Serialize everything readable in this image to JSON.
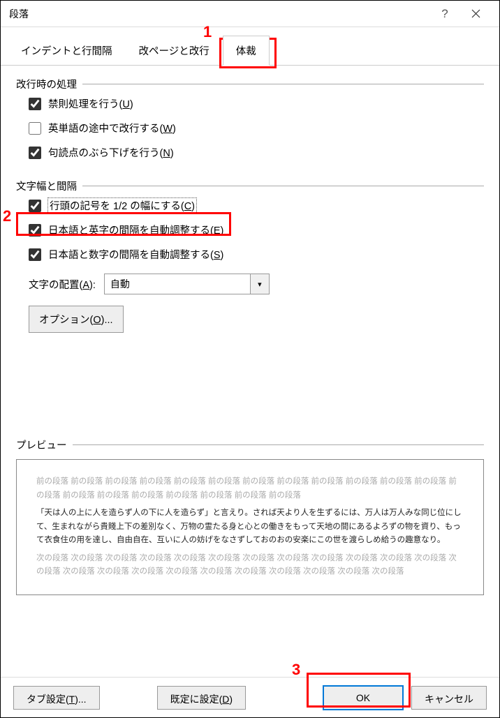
{
  "title": "段落",
  "tabs": [
    {
      "label": "インデントと行間隔",
      "active": false
    },
    {
      "label": "改ページと改行",
      "active": false
    },
    {
      "label": "体裁",
      "active": true
    }
  ],
  "groups": {
    "linebreak": {
      "legend": "改行時の処理",
      "items": [
        {
          "label": "禁則処理を行う(",
          "key": "U",
          "suffix": ")",
          "checked": true
        },
        {
          "label": "英単語の途中で改行する(",
          "key": "W",
          "suffix": ")",
          "checked": false
        },
        {
          "label": "句読点のぶら下げを行う(",
          "key": "N",
          "suffix": ")",
          "checked": true
        }
      ]
    },
    "spacing": {
      "legend": "文字幅と間隔",
      "items": [
        {
          "label": "行頭の記号を 1/2 の幅にする(",
          "key": "C",
          "suffix": ")",
          "checked": true
        },
        {
          "label": "日本語と英字の間隔を自動調整する(",
          "key": "E",
          "suffix": ")",
          "checked": true
        },
        {
          "label": "日本語と数字の間隔を自動調整する(",
          "key": "S",
          "suffix": ")",
          "checked": true
        }
      ],
      "align_label_pre": "文字の配置(",
      "align_key": "A",
      "align_label_post": "):",
      "align_value": "自動",
      "options_pre": "オプション(",
      "options_key": "O",
      "options_post": ")..."
    },
    "preview": {
      "legend": "プレビュー",
      "prev_para": "前の段落 前の段落 前の段落 前の段落 前の段落 前の段落 前の段落 前の段落 前の段落 前の段落 前の段落 前の段落 前の段落 前の段落 前の段落 前の段落 前の段落 前の段落 前の段落 前の段落",
      "main_para": "「天は人の上に人を造らず人の下に人を造らず」と言えり。されば天より人を生ずるには、万人は万人みな同じ位にして、生まれながら貴賤上下の差別なく、万物の霊たる身と心との働きをもって天地の間にあるよろずの物を資り、もって衣食住の用を達し、自由自在、互いに人の妨げをなさずしておのおの安楽にこの世を渡らしめ給うの趣意なり。",
      "next_para": "次の段落 次の段落 次の段落 次の段落 次の段落 次の段落 次の段落 次の段落 次の段落 次の段落 次の段落 次の段落 次の段落 次の段落 次の段落 次の段落 次の段落 次の段落 次の段落 次の段落 次の段落 次の段落 次の段落"
    }
  },
  "buttons": {
    "tab_settings_pre": "タブ設定(",
    "tab_settings_key": "T",
    "tab_settings_post": ")...",
    "set_default_pre": "既定に設定(",
    "set_default_key": "D",
    "set_default_post": ")",
    "ok": "OK",
    "cancel": "キャンセル"
  },
  "annotations": {
    "n1": "1",
    "n2": "2",
    "n3": "3"
  }
}
